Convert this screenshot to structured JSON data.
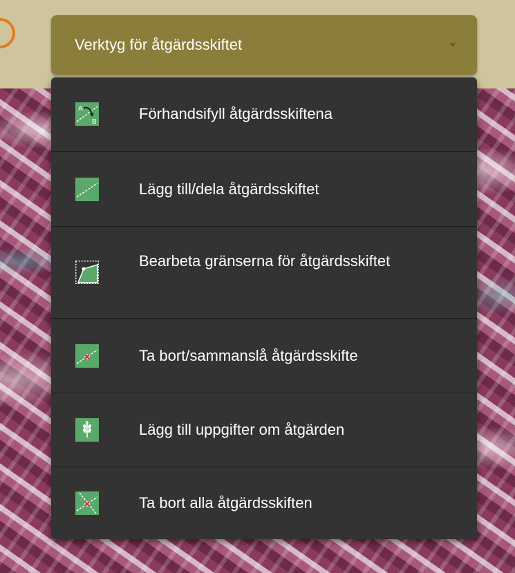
{
  "colors": {
    "topbar": "#cfc59c",
    "button": "#8b7d3a",
    "menu": "#333333",
    "icon_green": "#5aa86a",
    "accent_orange": "#e07a22"
  },
  "dropdown": {
    "label": "Verktyg för åtgärdsskiftet",
    "caret_icon": "caret-down-icon"
  },
  "menu": {
    "items": [
      {
        "label": "Förhandsifyll åtgärdsskiftena",
        "icon": "prefill-ab-icon"
      },
      {
        "label": "Lägg till/dela åtgärdsskiftet",
        "icon": "add-split-line-icon"
      },
      {
        "label": "Bearbeta gränserna för åtgärdsskiftet",
        "icon": "edit-boundary-icon"
      },
      {
        "label": "Ta bort/sammanslå åtgärdsskifte",
        "icon": "remove-merge-icon"
      },
      {
        "label": "Lägg till uppgifter om åtgärden",
        "icon": "wheat-icon"
      },
      {
        "label": "Ta bort alla åtgärdsskiften",
        "icon": "remove-all-icon"
      }
    ]
  }
}
